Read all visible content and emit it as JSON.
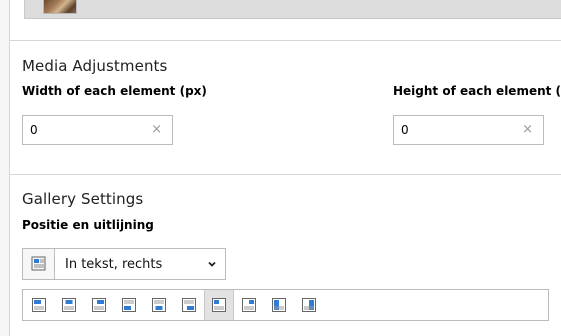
{
  "media_adjustments": {
    "title": "Media Adjustments",
    "width_label": "Width of each element (px)",
    "width_value": "0",
    "height_label": "Height of each element (px)",
    "height_value": "0"
  },
  "gallery_settings": {
    "title": "Gallery Settings",
    "position_label": "Positie en uitlijning",
    "position_selected": "In tekst, rechts",
    "alignment_options_icons": [
      "align-above-left-icon",
      "align-above-center-icon",
      "align-above-right-icon",
      "align-below-left-icon",
      "align-below-center-icon",
      "align-below-right-icon",
      "align-intext-right-icon",
      "align-intext-left-icon",
      "align-beside-right-icon",
      "align-beside-left-icon"
    ],
    "active_option_index": 6
  },
  "colors": {
    "accent_blue": "#2f7bd6",
    "border": "#bbbbbb",
    "active_bg": "#e2e2e2"
  },
  "icons": {
    "clear": "×",
    "clear_name": "close-icon"
  }
}
